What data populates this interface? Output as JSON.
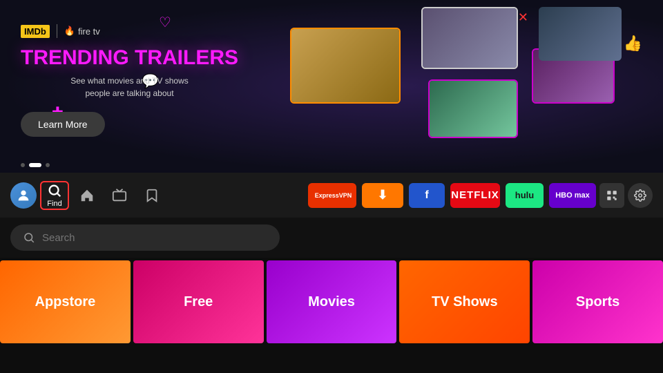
{
  "hero": {
    "logo_imdb": "IMDb",
    "logo_firetv": "fire tv",
    "title": "TRENDING TRAILERS",
    "subtitle_line1": "See what movies and TV shows",
    "subtitle_line2": "people are talking about",
    "learn_more": "Learn More"
  },
  "dots": [
    "dot1",
    "dot2-active",
    "dot3"
  ],
  "nav": {
    "find_label": "Find",
    "search_placeholder": "Search"
  },
  "apps": [
    {
      "id": "expressvpn",
      "label": "ExpressVPN"
    },
    {
      "id": "downloader",
      "label": "↓"
    },
    {
      "id": "filelinked",
      "label": "f"
    },
    {
      "id": "netflix",
      "label": "NETFLIX"
    },
    {
      "id": "hulu",
      "label": "hulu"
    },
    {
      "id": "hbomax",
      "label": "HBO max"
    }
  ],
  "categories": [
    {
      "id": "appstore",
      "label": "Appstore",
      "class": "cat-appstore"
    },
    {
      "id": "free",
      "label": "Free",
      "class": "cat-free"
    },
    {
      "id": "movies",
      "label": "Movies",
      "class": "cat-movies"
    },
    {
      "id": "tvshows",
      "label": "TV Shows",
      "class": "cat-tvshows"
    },
    {
      "id": "sports",
      "label": "Sports",
      "class": "cat-sports"
    }
  ]
}
